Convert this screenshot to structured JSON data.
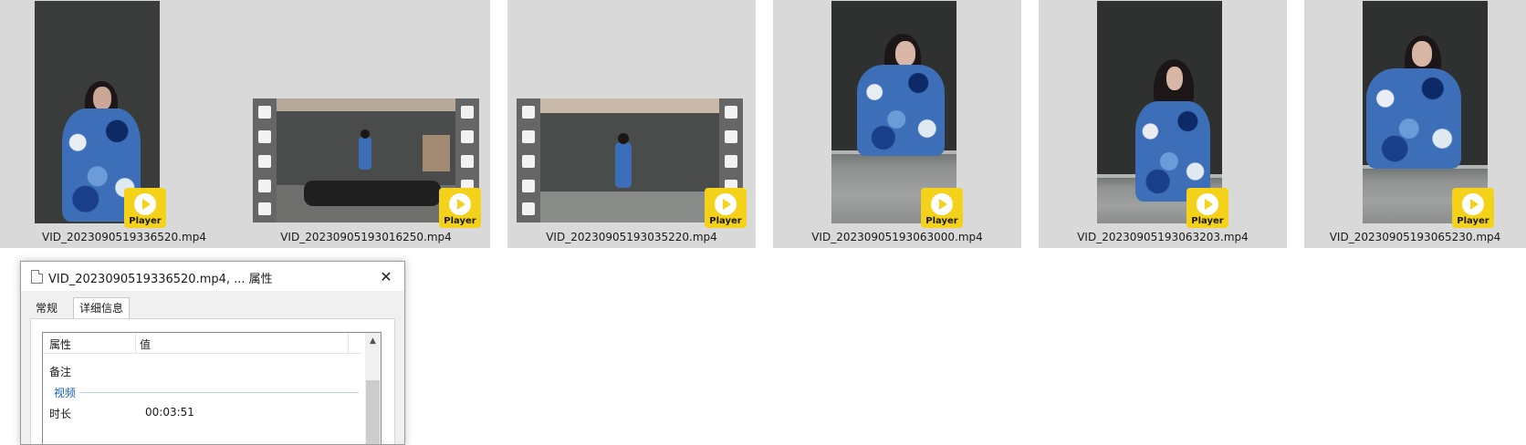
{
  "files": [
    {
      "name": "VID_2023090519336520.mp4",
      "badge": "Player"
    },
    {
      "name": "VID_20230905193016250.mp4",
      "badge": "Player"
    },
    {
      "name": "VID_20230905193035220.mp4",
      "badge": "Player"
    },
    {
      "name": "VID_20230905193063000.mp4",
      "badge": "Player"
    },
    {
      "name": "VID_20230905193063203.mp4",
      "badge": "Player"
    },
    {
      "name": "VID_20230905193065230.mp4",
      "badge": "Player"
    }
  ],
  "dialog": {
    "title": "VID_2023090519336520.mp4, ... 属性",
    "close": "✕",
    "tabs": [
      "常规",
      "详细信息"
    ],
    "columns": {
      "property": "属性",
      "value": "值"
    },
    "rows": {
      "remark": "备注",
      "group_video": "视频",
      "duration_label": "时长",
      "duration_value": "00:03:51"
    }
  },
  "colors": {
    "player_badge": "#f5d21a",
    "tile_bg": "#d9d9d9",
    "group_link": "#1a5fb4"
  }
}
